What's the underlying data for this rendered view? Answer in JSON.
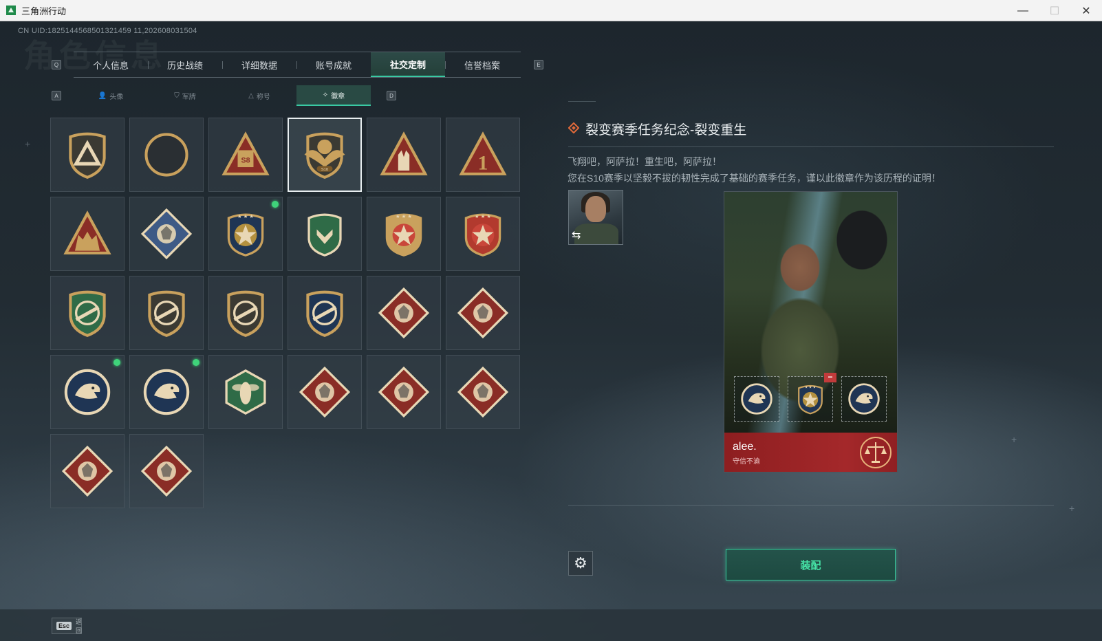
{
  "window": {
    "title": "三角洲行动",
    "minimize": "—",
    "maximize": "☐",
    "close": "✕"
  },
  "uid_text": "CN UID:1825144568501321459 11,202608031504",
  "watermark": "角色信息",
  "keys": {
    "prev_main": "Q",
    "next_main": "E",
    "prev_sub": "A",
    "next_sub": "D"
  },
  "main_tabs": [
    {
      "label": "个人信息",
      "active": false
    },
    {
      "label": "历史战绩",
      "active": false
    },
    {
      "label": "详细数据",
      "active": false
    },
    {
      "label": "账号成就",
      "active": false
    },
    {
      "label": "社交定制",
      "active": true
    },
    {
      "label": "信誉档案",
      "active": false
    }
  ],
  "sub_tabs": [
    {
      "label": "头像",
      "icon": "person-icon",
      "glyph": "👤",
      "active": false
    },
    {
      "label": "军牌",
      "icon": "tag-icon",
      "glyph": "⛉",
      "active": false
    },
    {
      "label": "称号",
      "icon": "triangle-icon",
      "glyph": "△",
      "active": false
    },
    {
      "label": "徽章",
      "icon": "wings-icon",
      "glyph": "✧",
      "active": true
    }
  ],
  "badges": [
    {
      "icon": "delta-shield-icon",
      "new": false,
      "selected": false
    },
    {
      "icon": "helicopter-icon",
      "new": false,
      "selected": false
    },
    {
      "icon": "s8-triangle-icon",
      "new": false,
      "selected": false
    },
    {
      "icon": "s10-eagle-icon",
      "new": false,
      "selected": true
    },
    {
      "icon": "rock-hand-icon",
      "new": false,
      "selected": false
    },
    {
      "icon": "number-one-icon",
      "new": false,
      "selected": false
    },
    {
      "icon": "squad-triangle-icon",
      "new": false,
      "selected": false
    },
    {
      "icon": "rose-diamond-icon",
      "new": false,
      "selected": false
    },
    {
      "icon": "star-medal-icon",
      "new": true,
      "selected": false
    },
    {
      "icon": "green-shield-icon",
      "new": false,
      "selected": false
    },
    {
      "icon": "gold-star-medal-icon",
      "new": false,
      "selected": false
    },
    {
      "icon": "red-star-medal-icon",
      "new": false,
      "selected": false
    },
    {
      "icon": "rifle-green-shield-icon",
      "new": false,
      "selected": false
    },
    {
      "icon": "smg-shield-icon",
      "new": false,
      "selected": false
    },
    {
      "icon": "sniper-shield-icon",
      "new": false,
      "selected": false
    },
    {
      "icon": "gold-crosshair-shield-icon",
      "new": false,
      "selected": false
    },
    {
      "icon": "wolf-diamond-icon",
      "new": false,
      "selected": false
    },
    {
      "icon": "wolf-diamond-2-icon",
      "new": false,
      "selected": false
    },
    {
      "icon": "eagle-circle-icon",
      "new": true,
      "selected": false
    },
    {
      "icon": "eagle-circle-2-icon",
      "new": true,
      "selected": false
    },
    {
      "icon": "wasp-hexagon-icon",
      "new": false,
      "selected": false
    },
    {
      "icon": "dragon-diamond-icon",
      "new": false,
      "selected": false
    },
    {
      "icon": "dragon-diamond-2-icon",
      "new": false,
      "selected": false
    },
    {
      "icon": "runner-diamond-icon",
      "new": false,
      "selected": false
    },
    {
      "icon": "snake-diamond-icon",
      "new": false,
      "selected": false
    },
    {
      "icon": "wheel-diamond-icon",
      "new": false,
      "selected": false
    }
  ],
  "detail": {
    "title": "裂变赛季任务纪念-裂变重生",
    "desc_line1": "飞翔吧，阿萨拉！重生吧，阿萨拉！",
    "desc_line2": "您在S10赛季以坚毅不拔的韧性完成了基础的赛季任务，谨以此徽章作为该历程的证明！",
    "swap_glyph": "⇆"
  },
  "card": {
    "name": "alee.",
    "subtitle": "守信不渝",
    "slot_minus": "−"
  },
  "equip_label": "装配",
  "settings_glyph": "⚙",
  "esc": {
    "key": "Esc",
    "label": "返回"
  },
  "colors": {
    "accent": "#39c9a3",
    "equip_text": "#46e3a6",
    "new_dot": "#3fd37a",
    "card_banner": "#a4282a"
  }
}
